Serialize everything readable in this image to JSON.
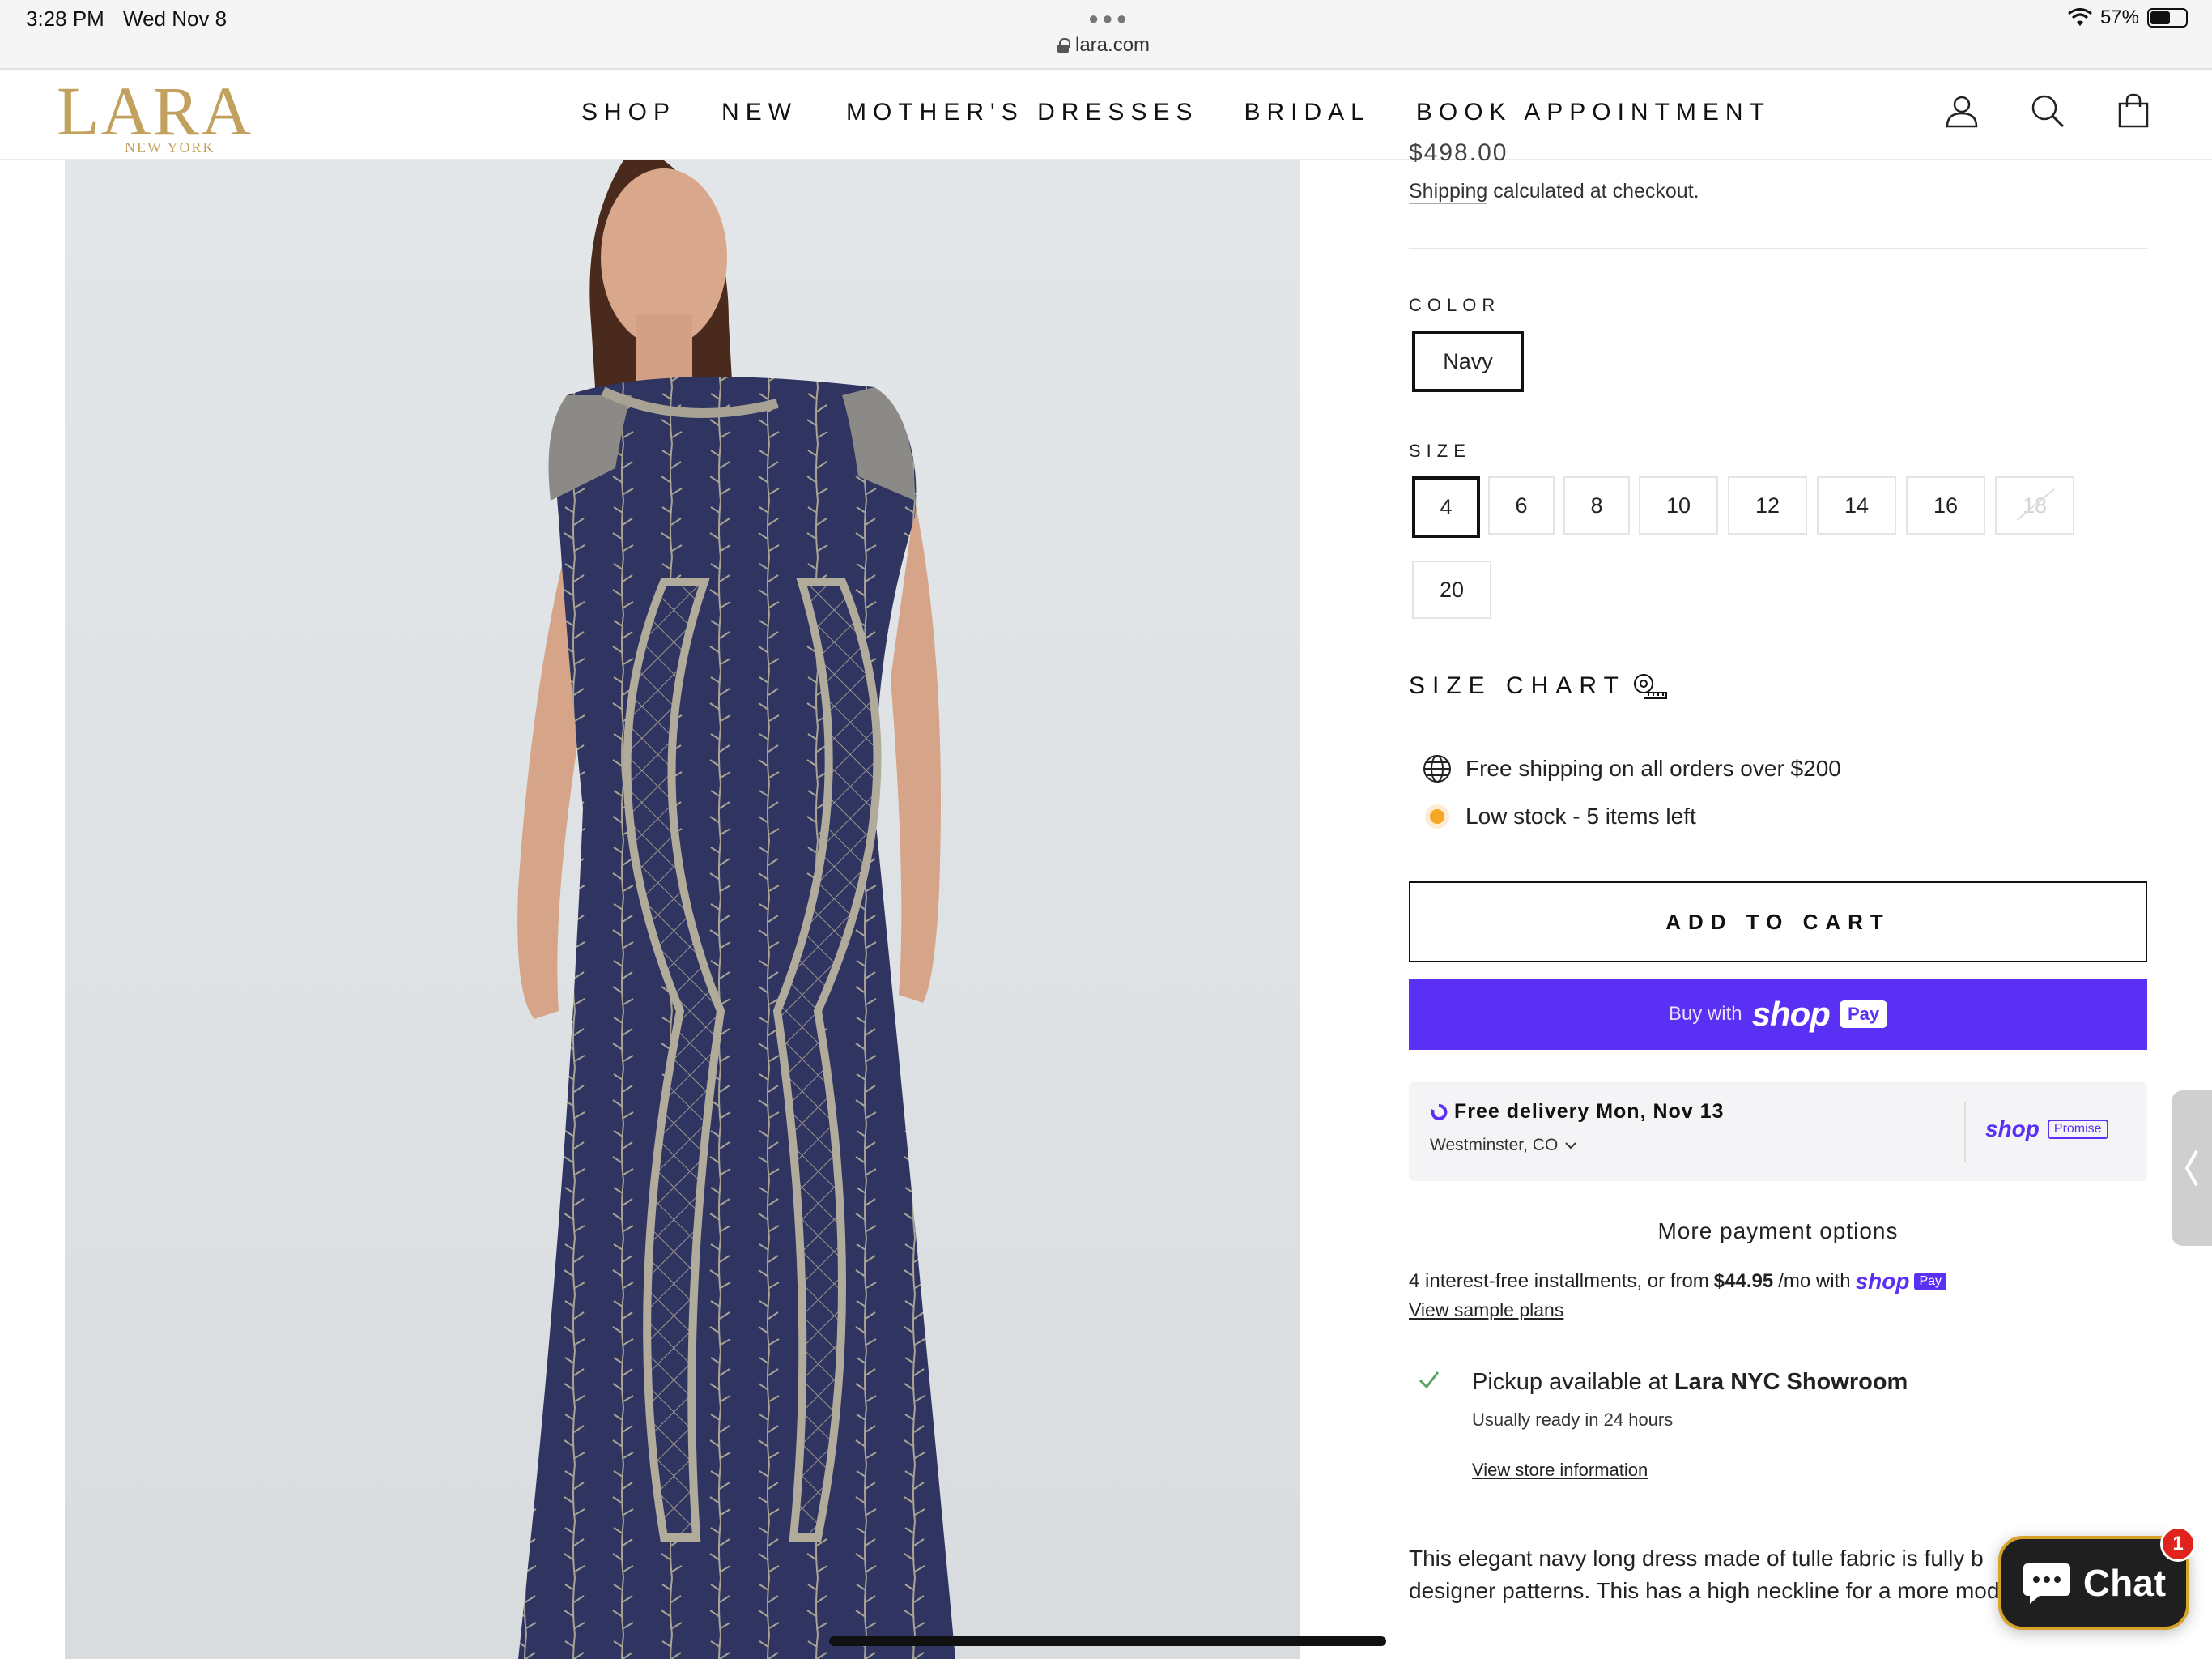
{
  "status_bar": {
    "time": "3:28 PM",
    "date": "Wed Nov 8",
    "url": "lara.com",
    "battery": "57%",
    "battery_level": 0.57
  },
  "header": {
    "logo_main": "LARA",
    "logo_sub": "NEW YORK",
    "nav": [
      "SHOP",
      "NEW",
      "MOTHER'S DRESSES",
      "BRIDAL",
      "BOOK APPOINTMENT"
    ],
    "icons": [
      "account-icon",
      "search-icon",
      "cart-icon"
    ]
  },
  "product": {
    "price_partial": "$498.00",
    "shipping_link": "Shipping",
    "shipping_rest": " calculated at checkout.",
    "color_label": "COLOR",
    "colors": [
      "Navy"
    ],
    "selected_color": "Navy",
    "size_label": "SIZE",
    "sizes": [
      "4",
      "6",
      "8",
      "10",
      "12",
      "14",
      "16",
      "18",
      "20"
    ],
    "selected_size": "4",
    "unavailable_sizes": [
      "18"
    ],
    "size_chart": "SIZE CHART",
    "free_shipping": "Free shipping on all orders over $200",
    "low_stock": "Low stock - 5 items left",
    "add_to_cart": "ADD TO CART",
    "buy_with": "Buy with",
    "shop_word": "shop",
    "pay_word": "Pay",
    "delivery_title": "Free delivery Mon, Nov 13",
    "delivery_location": "Westminster, CO",
    "promise_brand": "shop",
    "promise_word": "Promise",
    "more_payment": "More payment options",
    "installments_pre": "4 interest-free installments, or from",
    "installments_amount": "$44.95",
    "installments_post": "/mo with",
    "sample_plans": "View sample plans",
    "pickup_pre": "Pickup available at",
    "pickup_location": "Lara NYC Showroom",
    "pickup_ready": "Usually ready in 24 hours",
    "store_info": "View store information",
    "description_line1": "This elegant navy long dress made of tulle fabric is fully b",
    "description_line2": "designer patterns. This has a high neckline for a more mod"
  },
  "chat": {
    "label": "Chat",
    "badge": "1"
  },
  "colors": {
    "gold": "#c2a15e",
    "shop_purple": "#5a31f4",
    "low_stock_dot": "#f6a623",
    "dress_navy": "#2f3560"
  }
}
